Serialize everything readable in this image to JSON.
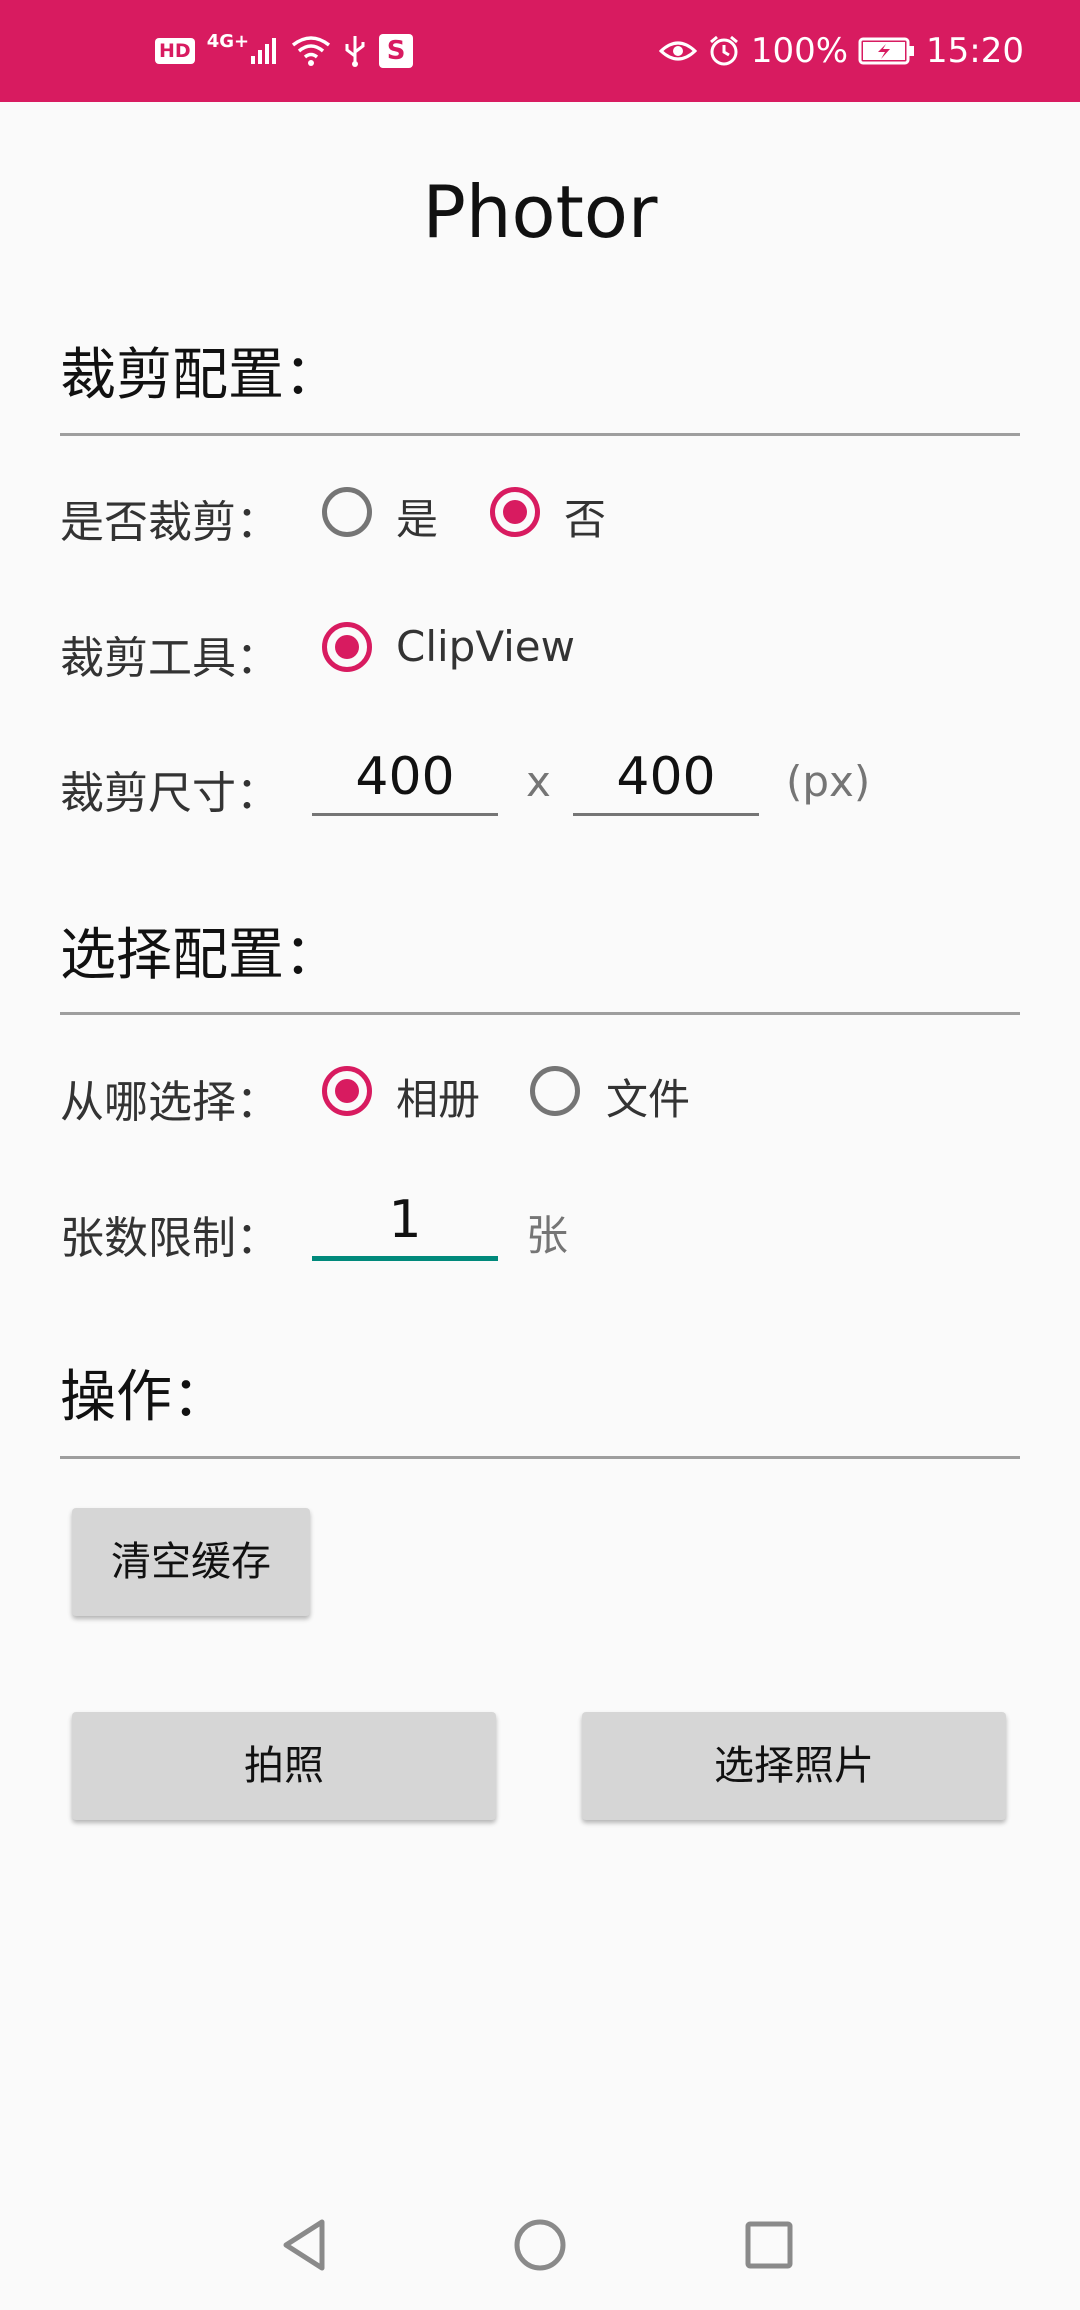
{
  "status_bar": {
    "left_icons": [
      "hd-icon",
      "signal-4g-icon",
      "wifi-icon",
      "usb-icon",
      "app-notification-icon"
    ],
    "hd_label": "HD",
    "network_label": "4G+",
    "right_icons": [
      "eye-comfort-icon",
      "alarm-icon",
      "battery-charging-icon"
    ],
    "battery": "100%",
    "time": "15:20",
    "color": "#d81b60"
  },
  "app": {
    "title": "Photor"
  },
  "crop_config": {
    "heading": "裁剪配置：",
    "enable_crop": {
      "label": "是否裁剪：",
      "options": [
        {
          "label": "是",
          "checked": false
        },
        {
          "label": "否",
          "checked": true
        }
      ]
    },
    "crop_tool": {
      "label": "裁剪工具：",
      "options": [
        {
          "label": "ClipView",
          "checked": true
        }
      ]
    },
    "crop_size": {
      "label": "裁剪尺寸：",
      "width": "400",
      "separator": "x",
      "height": "400",
      "unit": "(px)"
    }
  },
  "select_config": {
    "heading": "选择配置：",
    "source": {
      "label": "从哪选择：",
      "options": [
        {
          "label": "相册",
          "checked": true
        },
        {
          "label": "文件",
          "checked": false
        }
      ]
    },
    "count_limit": {
      "label": "张数限制：",
      "value": "1",
      "unit": "张"
    }
  },
  "actions": {
    "heading": "操作：",
    "clear_cache": "清空缓存",
    "take_photo": "拍照",
    "choose_photo": "选择照片"
  },
  "colors": {
    "accent": "#d81b60",
    "focus_underline": "#00897b",
    "background": "#fafafa",
    "button": "#d6d6d6"
  },
  "nav_bar": {
    "icons": [
      "back-icon",
      "home-icon",
      "recents-icon"
    ]
  }
}
